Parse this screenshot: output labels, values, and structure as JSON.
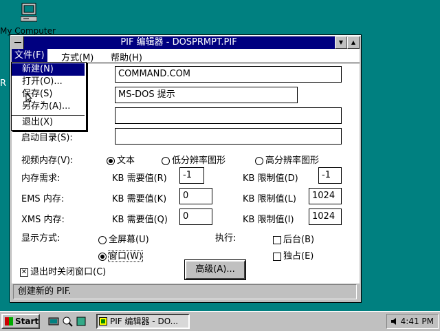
{
  "desktop": {
    "icon_label": "My Computer",
    "partial_label": "R"
  },
  "window": {
    "title": "PIF 编辑器 - DOSPRMPT.PIF",
    "menus": [
      "文件(F)",
      "方式(M)",
      "帮助(H)"
    ],
    "file_menu": {
      "items": [
        "新建(N)",
        "打开(O)...",
        "保存(S)",
        "另存为(A)...",
        "退出(X)"
      ],
      "selected_index": 0
    },
    "fields": {
      "program_value": "COMMAND.COM",
      "title_value": "MS-DOS 提示",
      "params_value": "",
      "startdir_label": "启动目录(S):",
      "startdir_value": ""
    },
    "video": {
      "label": "视频内存(V):",
      "options": [
        "文本",
        "低分辨率图形",
        "高分辨率图形"
      ],
      "selected_index": 0
    },
    "memory": {
      "label": "内存需求:",
      "req_label": "KB 需要值(R)",
      "req_value": "-1",
      "lim_label": "KB 限制值(D)",
      "lim_value": "-1"
    },
    "ems": {
      "label": "EMS 内存:",
      "req_label": "KB 需要值(K)",
      "req_value": "0",
      "lim_label": "KB 限制值(L)",
      "lim_value": "1024"
    },
    "xms": {
      "label": "XMS 内存:",
      "req_label": "KB 需要值(Q)",
      "req_value": "0",
      "lim_label": "KB 限制值(I)",
      "lim_value": "1024"
    },
    "display": {
      "label": "显示方式:",
      "options": [
        "全屏幕(U)",
        "窗口(W)"
      ],
      "selected_index": 1
    },
    "execution": {
      "label": "执行:",
      "options": [
        "后台(B)",
        "独占(E)"
      ],
      "checked": [
        false,
        false
      ]
    },
    "close_on_exit": {
      "label": "退出时关闭窗口(C)",
      "checked": true
    },
    "advanced_button": "高级(A)...",
    "status": "创建新的 PIF."
  },
  "taskbar": {
    "start_label": "Start",
    "task_label": "PIF 编辑器 - DO...",
    "clock": "4:41 PM"
  }
}
